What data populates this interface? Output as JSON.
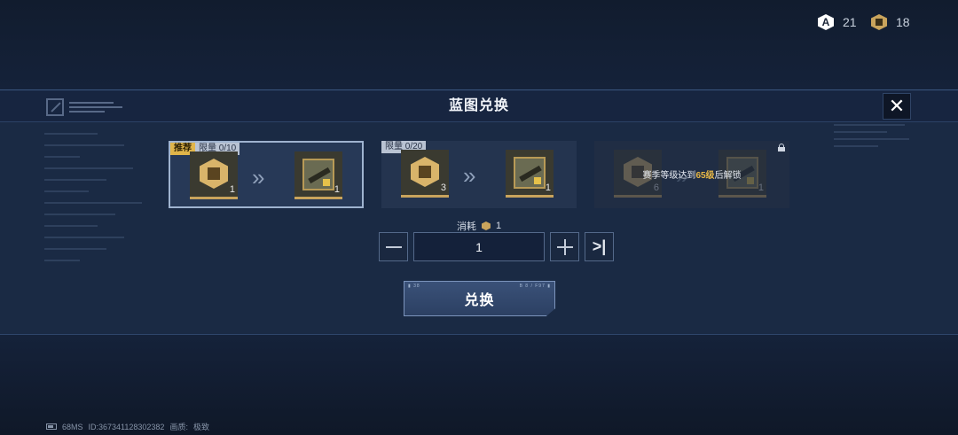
{
  "currencies": [
    {
      "icon": "blueprint-token-icon",
      "glyph": "A",
      "amount": "21"
    },
    {
      "icon": "gold-chip-icon",
      "amount": "18"
    }
  ],
  "dialog": {
    "title": "蓝图兑换",
    "close_label": "✕"
  },
  "cards": [
    {
      "recommended": true,
      "tag_recommended": "推荐",
      "limit": "限量 0/10",
      "input_count": "1",
      "output_count": "1",
      "arrows": "»",
      "locked": false
    },
    {
      "recommended": false,
      "limit": "限量 0/20",
      "input_count": "3",
      "output_count": "1",
      "arrows": "»",
      "locked": false
    },
    {
      "recommended": false,
      "limit": "",
      "input_count": "6",
      "output_count": "1",
      "arrows": "»",
      "locked": true,
      "unlock_prefix": "赛季等级达到",
      "unlock_level": "65级",
      "unlock_suffix": "后解锁"
    }
  ],
  "cost": {
    "label": "消耗",
    "amount": "1"
  },
  "stepper": {
    "value": "1",
    "max_glyph": ">|"
  },
  "exchange_button": {
    "label": "兑换",
    "corner_left": "▮ 38",
    "corner_right": "B 8 / F97 ▮"
  },
  "footer": {
    "ping": "68MS",
    "id_text": "ID:367341128302382",
    "quality_label": "画质:",
    "quality_value": "极致"
  },
  "colors": {
    "accent_gold": "#e8b847",
    "panel_bg": "#1a2a44",
    "button_bg": "#34496e"
  }
}
